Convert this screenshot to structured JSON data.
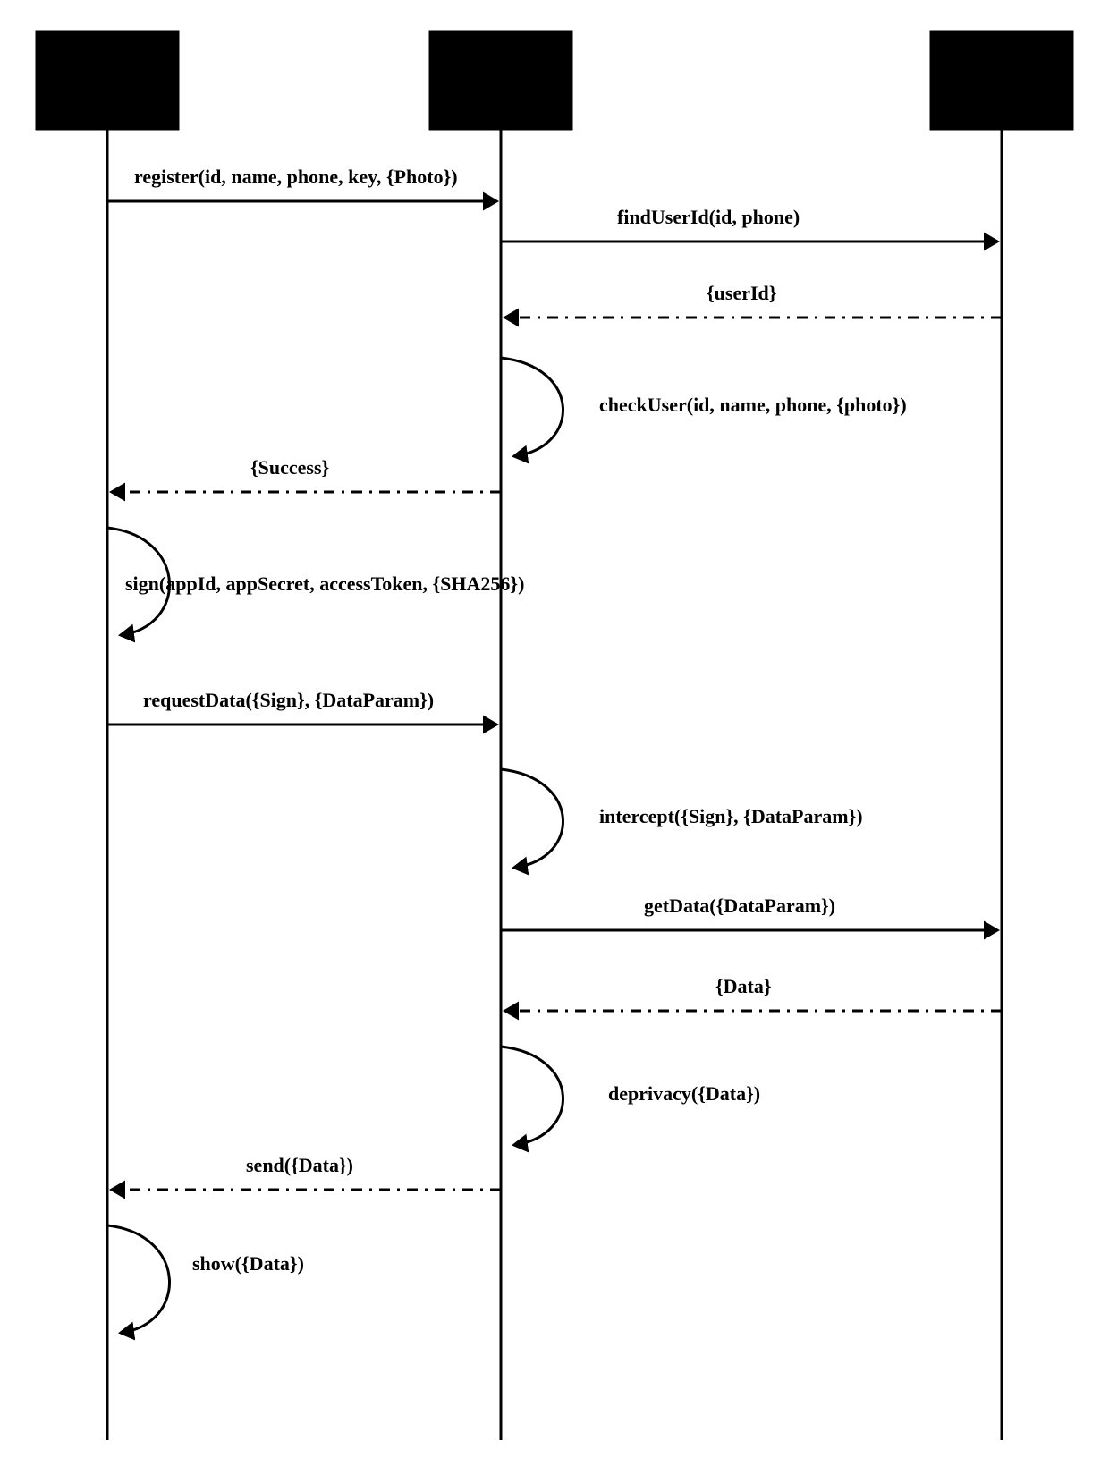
{
  "diagram": {
    "type": "sequence",
    "participants": [
      "",
      "",
      ""
    ],
    "messages": {
      "m1": "register(id, name, phone, key, {Photo})",
      "m2": "findUserId(id, phone)",
      "m3": "{userId}",
      "m4": "checkUser(id, name, phone, {photo})",
      "m5": "{Success}",
      "m6": "sign(appId, appSecret, accessToken, {SHA256})",
      "m7": "requestData({Sign}, {DataParam})",
      "m8": "intercept({Sign}, {DataParam})",
      "m9": "getData({DataParam})",
      "m10": "{Data}",
      "m11": "deprivacy({Data})",
      "m12": "send({Data})",
      "m13": "show({Data})"
    }
  }
}
